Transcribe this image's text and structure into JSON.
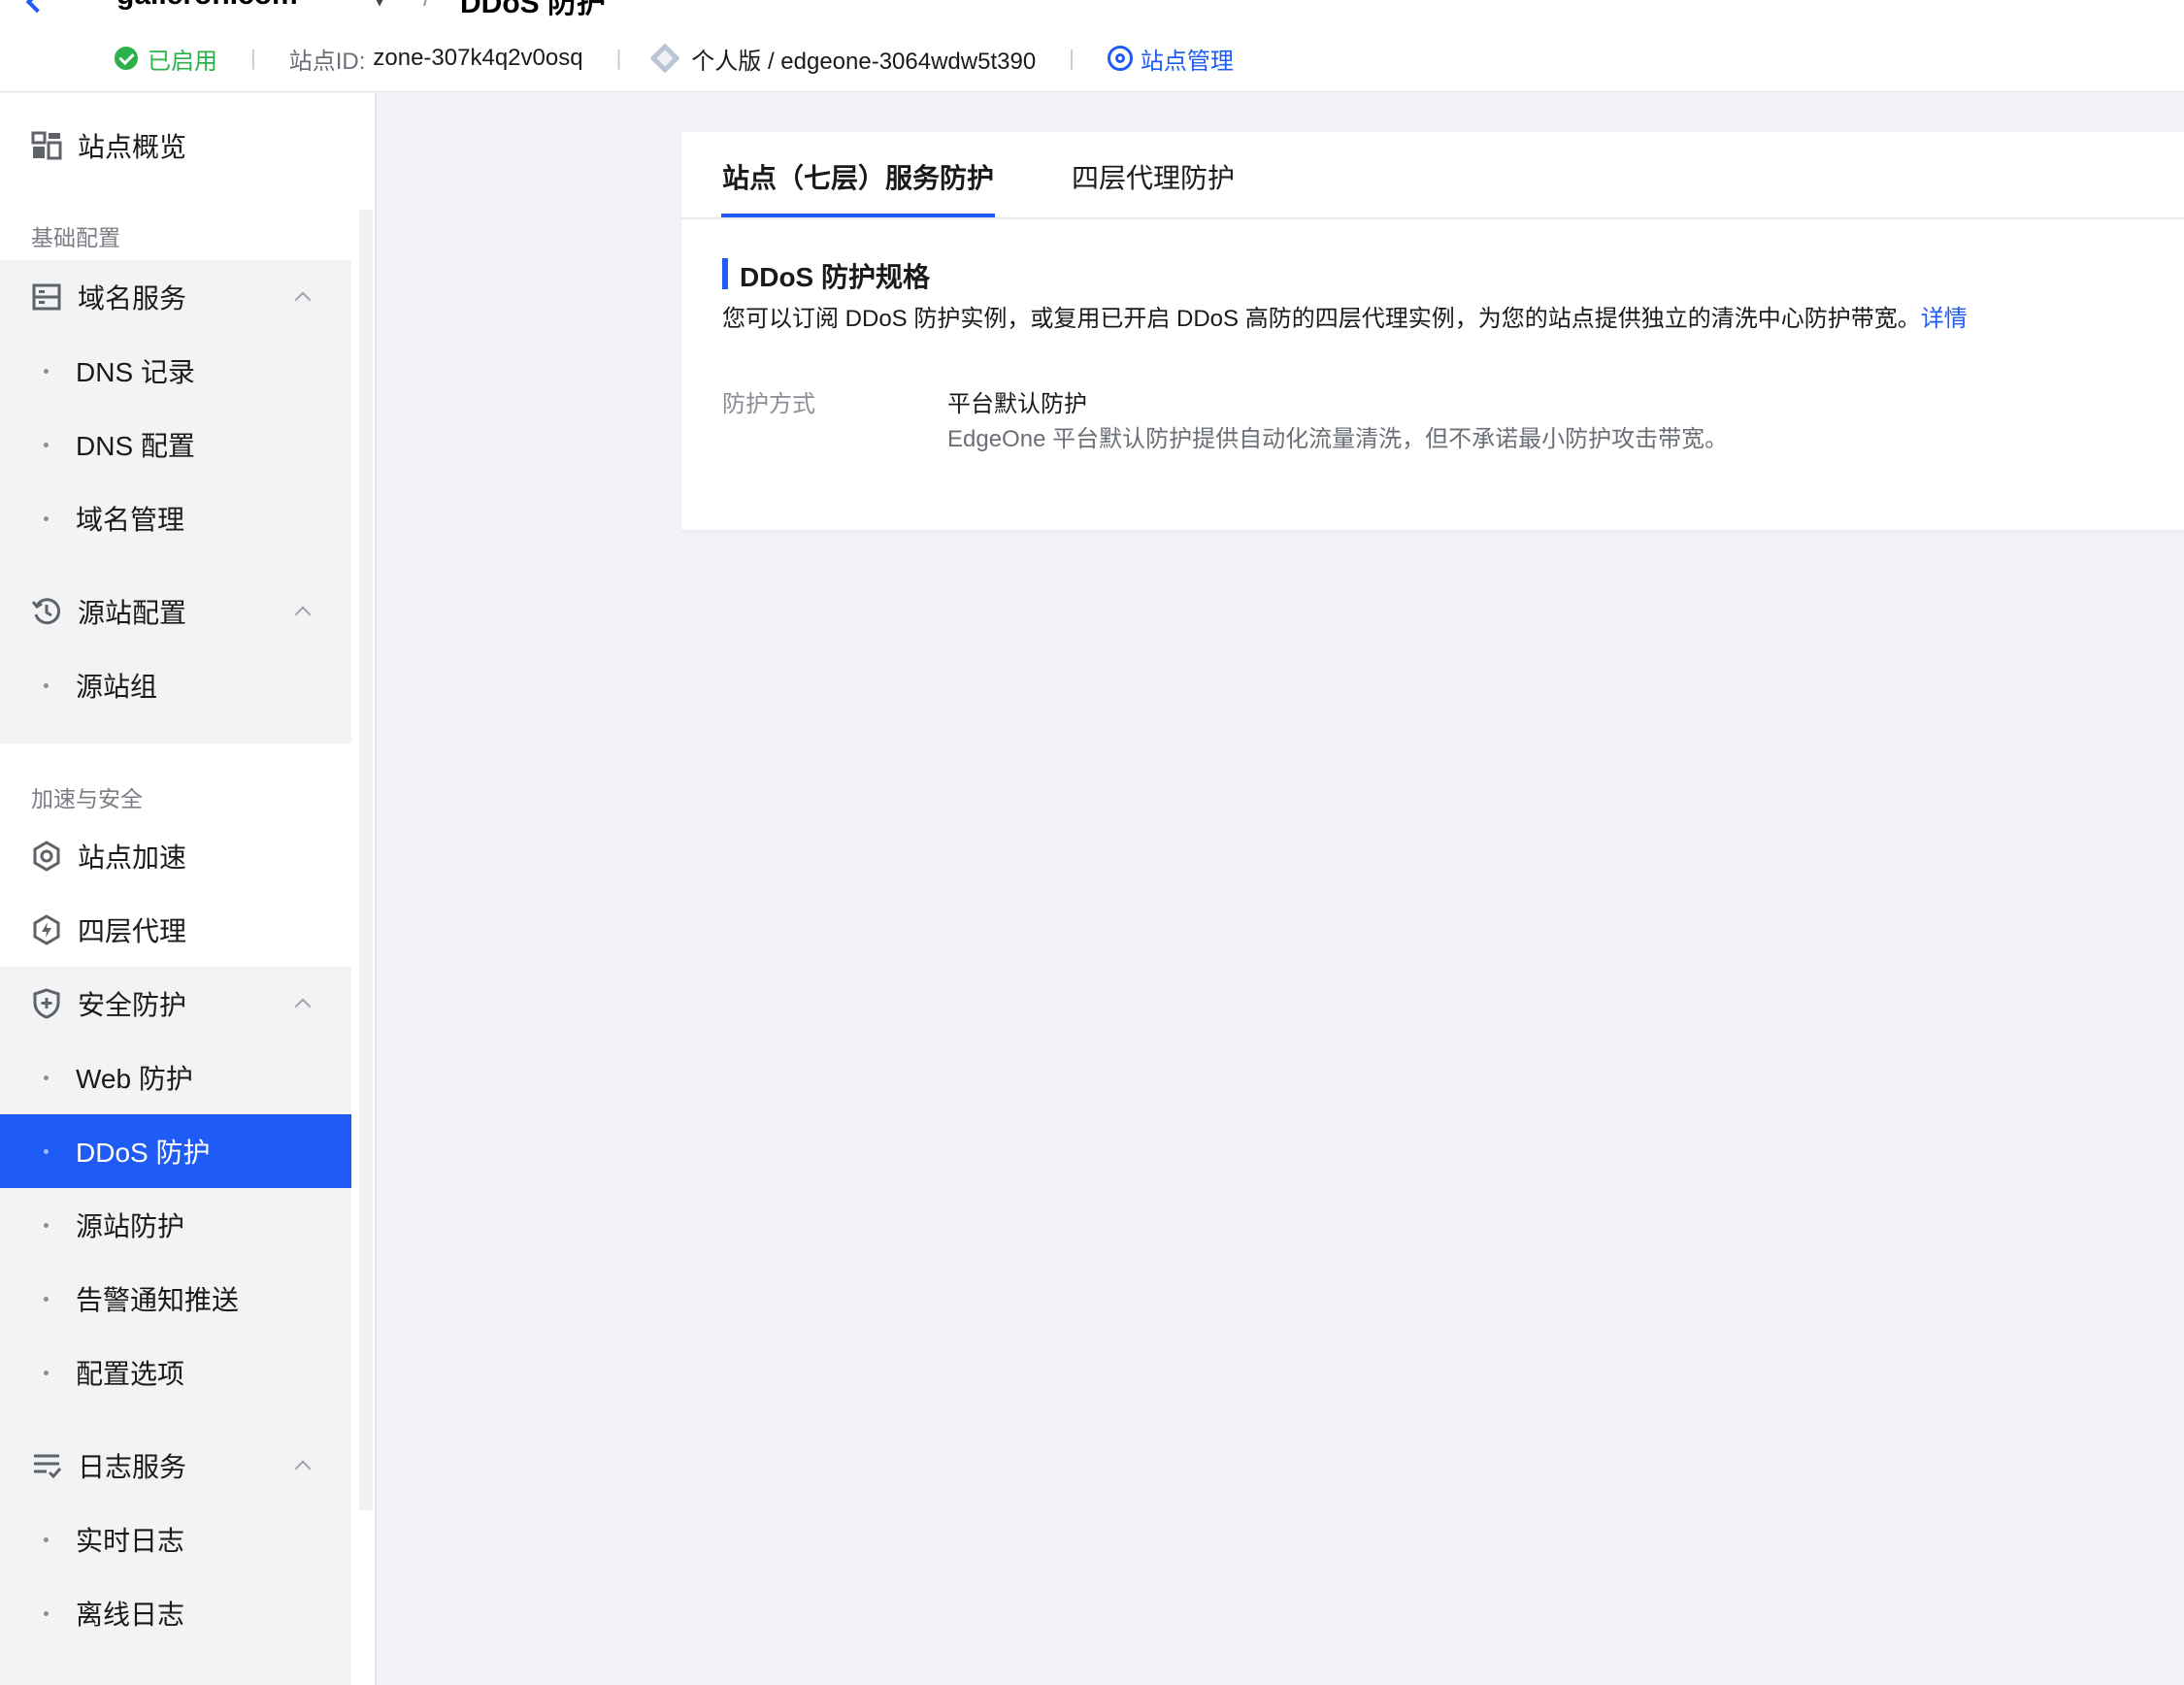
{
  "header": {
    "site_name": "galleroh.com",
    "page_title": "DDoS 防护",
    "status": "已启用",
    "site_id_label": "站点ID:",
    "site_id": "zone-307k4q2v0osq",
    "plan": "个人版 / edgeone-3064wdw5t390",
    "manage_link": "站点管理"
  },
  "sidebar": {
    "overview": "站点概览",
    "section_basic": "基础配置",
    "domain_service": {
      "label": "域名服务",
      "items": [
        "DNS 记录",
        "DNS 配置",
        "域名管理"
      ]
    },
    "origin_config": {
      "label": "源站配置",
      "items": [
        "源站组"
      ]
    },
    "section_accel": "加速与安全",
    "site_accel": "站点加速",
    "l4_proxy": "四层代理",
    "security": {
      "label": "安全防护",
      "items": [
        "Web 防护",
        "DDoS 防护",
        "源站防护",
        "告警通知推送",
        "配置选项"
      ],
      "active_index": 1
    },
    "log_service": {
      "label": "日志服务",
      "items": [
        "实时日志",
        "离线日志"
      ]
    }
  },
  "main": {
    "tabs": [
      "站点（七层）服务防护",
      "四层代理防护"
    ],
    "active_tab": 0,
    "section_title": "DDoS 防护规格",
    "description": "您可以订阅 DDoS 防护实例，或复用已开启 DDoS 高防的四层代理实例，为您的站点提供独立的清洗中心防护带宽。",
    "detail_link": "详情",
    "field_label": "防护方式",
    "field_value": "平台默认防护",
    "field_help": "EdgeOne 平台默认防护提供自动化流量清洗，但不承诺最小防护攻击带宽。"
  },
  "colors": {
    "accent": "#1f5bf5",
    "success": "#2bb04a"
  }
}
